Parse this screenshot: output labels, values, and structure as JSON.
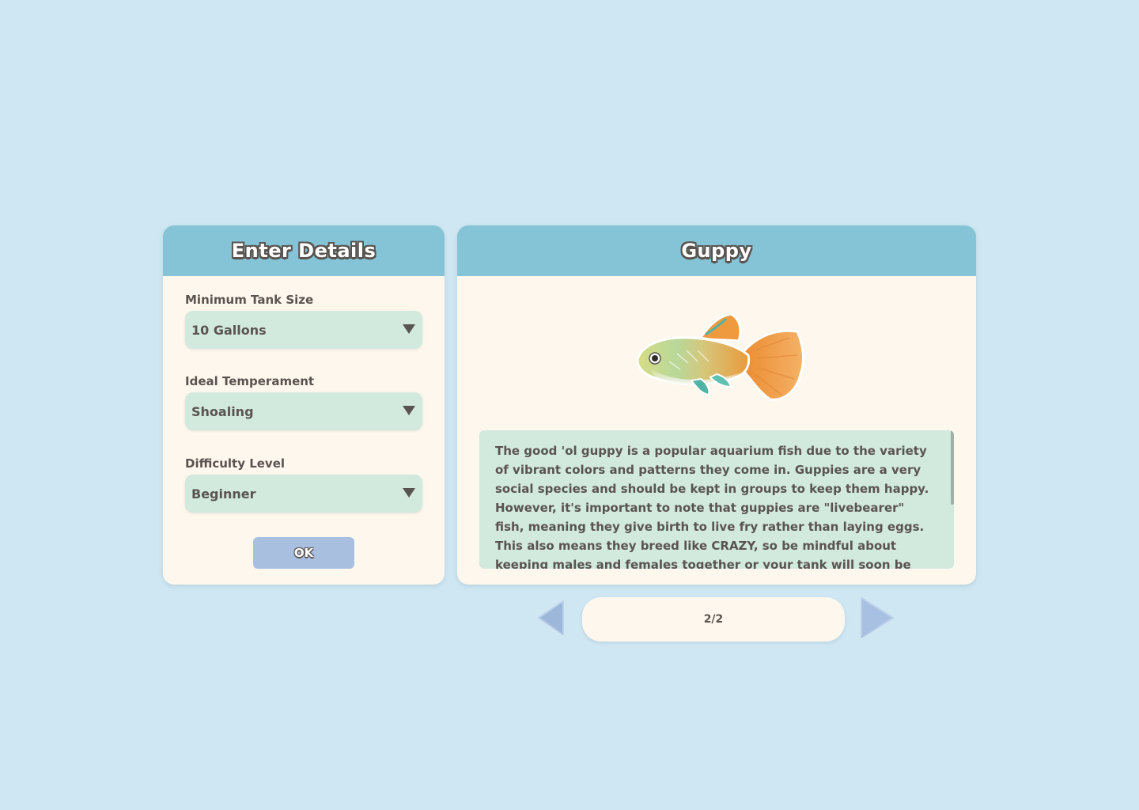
{
  "details_panel": {
    "title": "Enter Details",
    "fields": [
      {
        "label": "Minimum Tank Size",
        "value": "10 Gallons"
      },
      {
        "label": "Ideal Temperament",
        "value": "Shoaling"
      },
      {
        "label": "Difficulty Level",
        "value": "Beginner"
      }
    ],
    "ok_label": "OK"
  },
  "fish_panel": {
    "title": "Guppy",
    "image": "guppy-fish",
    "description": "The good 'ol guppy is a popular aquarium fish due to the variety of vibrant colors and patterns they come in. Guppies are a very social species and should be kept in groups to keep them happy. However, it's important to note that guppies are \"livebearer\" fish, meaning they give birth to live fry rather than laying eggs. This also means they breed like CRAZY, so be mindful about keeping males and females together or your tank will soon be overrun with guppies. Male only or"
  },
  "pager": {
    "text": "2/2",
    "prev_icon": "left-arrow-icon",
    "next_icon": "right-arrow-icon"
  },
  "colors": {
    "background": "#cfe7f2",
    "header": "#84c4d6",
    "panel": "#fef7ee",
    "field": "#d2e9de",
    "button": "#a8bfe0",
    "text": "#5a5450"
  }
}
